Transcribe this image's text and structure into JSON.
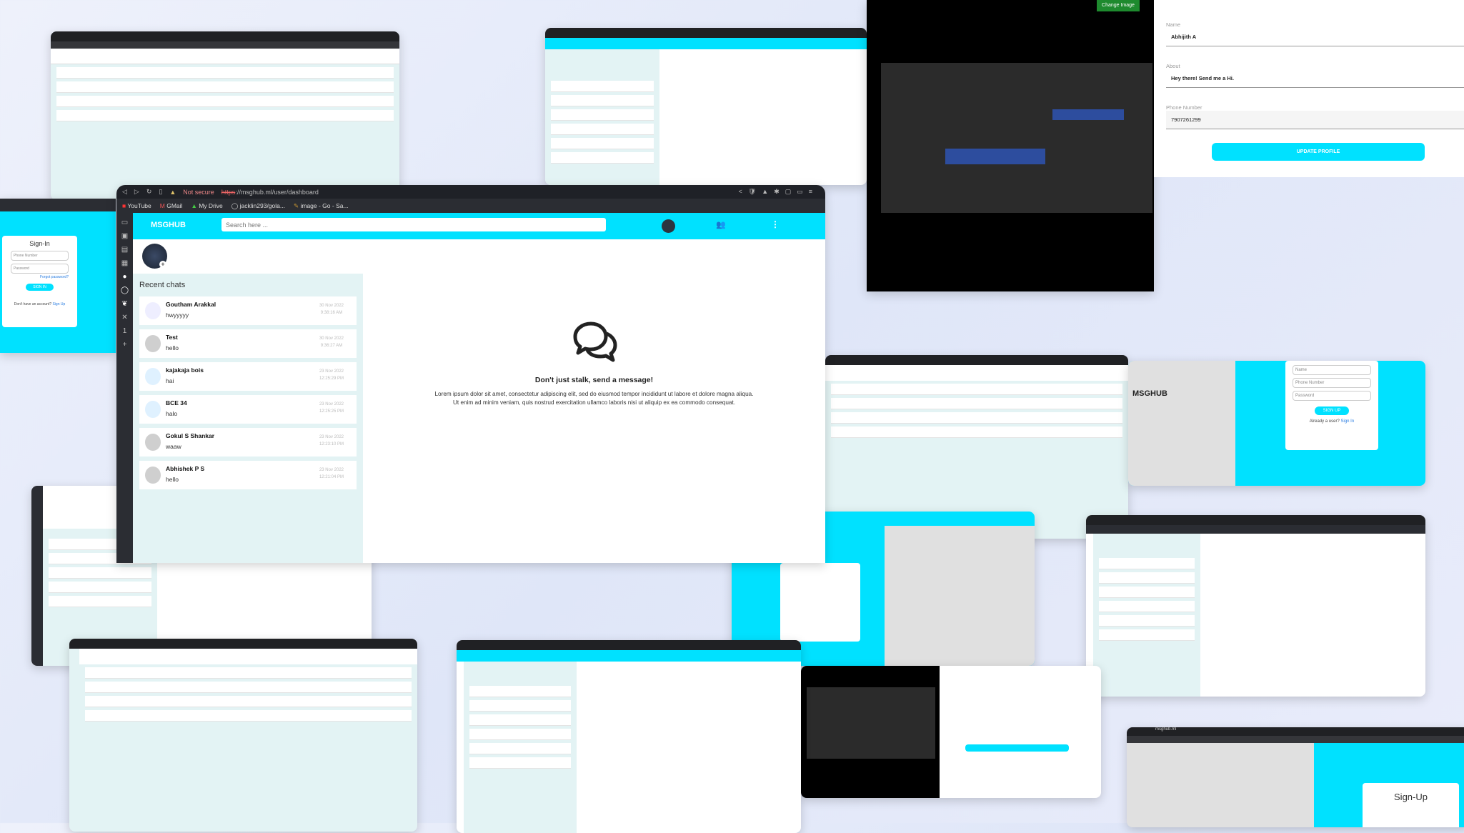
{
  "main": {
    "browser": {
      "security": "Not secure",
      "url_scheme": "https",
      "url_rest": "://msghub.ml/user/dashboard"
    },
    "bookmarks": [
      "YouTube",
      "GMail",
      "My Drive",
      "jacklin293/gola...",
      "image - Go - Sa..."
    ],
    "header": {
      "logo": "MSGHUB",
      "search_placeholder": "Search here ..."
    },
    "recent_chats_label": "Recent chats",
    "chats": [
      {
        "name": "Goutham Arakkal",
        "message": "hwyyyyy",
        "date": "30 Nov 2022",
        "time": "9:38:16 AM"
      },
      {
        "name": "Test",
        "message": "hello",
        "date": "30 Nov 2022",
        "time": "9:36:27 AM"
      },
      {
        "name": "kajakaja bois",
        "message": "hai",
        "date": "23 Nov 2022",
        "time": "12:25:29 PM"
      },
      {
        "name": "BCE 34",
        "message": "halo",
        "date": "23 Nov 2022",
        "time": "12:25:25 PM"
      },
      {
        "name": "Gokul S Shankar",
        "message": "waaw",
        "date": "23 Nov 2022",
        "time": "12:23:10 PM"
      },
      {
        "name": "Abhishek P S",
        "message": "hello",
        "date": "23 Nov 2022",
        "time": "12:21:04 PM"
      }
    ],
    "empty_state": {
      "title": "Don't just stalk, send a message!",
      "body": "Lorem ipsum dolor sit amet, consectetur adipiscing elit, sed do eiusmod tempor incididunt ut labore et dolore magna aliqua. Ut enim ad minim veniam, quis nostrud exercitation ullamco laboris nisi ut aliquip ex ea commodo consequat."
    }
  },
  "profile": {
    "name_label": "Name",
    "name_value": "Abhijith A",
    "about_label": "About",
    "about_value": "Hey there! Send me a Hi.",
    "phone_label": "Phone Number",
    "phone_value": "7907261299",
    "update_button": "UPDATE PROFILE"
  },
  "code_window": {
    "change_image": "Change Image"
  },
  "signin": {
    "title": "Sign-In",
    "phone_placeholder": "Phone Number",
    "password_placeholder": "Password",
    "forgot": "Forgot password?",
    "button": "SIGN IN",
    "no_account": "Don't have an account?",
    "signup_link": "Sign Up"
  },
  "signup": {
    "brand": "MSGHUB",
    "name_placeholder": "Name",
    "phone_placeholder": "Phone Number",
    "password_placeholder": "Password",
    "button": "SIGN UP",
    "already": "Already a user?",
    "signin_link": "Sign In",
    "title": "Sign-Up",
    "url": "msghub.ml"
  },
  "colors": {
    "accent": "#00e1ff",
    "browser_dark": "#2b2d33",
    "chat_list_bg": "#e3f3f4"
  }
}
